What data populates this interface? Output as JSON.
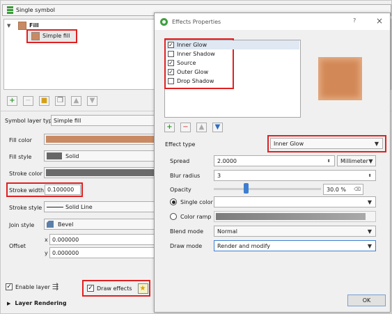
{
  "left_panel": {
    "header": {
      "title": "Single symbol"
    },
    "tree": {
      "root_label": "Fill",
      "child_label": "Simple fill"
    },
    "layer_type": {
      "label": "Symbol layer type",
      "value": "Simple fill"
    },
    "props": {
      "fill_color": {
        "label": "Fill color",
        "color": "#c98a63"
      },
      "fill_style": {
        "label": "Fill style",
        "value": "Solid"
      },
      "stroke_color": {
        "label": "Stroke color",
        "color": "#6b6b6b"
      },
      "stroke_width": {
        "label": "Stroke width",
        "value": "0.100000"
      },
      "stroke_style": {
        "label": "Stroke style",
        "value": "Solid Line"
      },
      "join_style": {
        "label": "Join style",
        "value": "Bevel"
      },
      "offset": {
        "label": "Offset",
        "x_label": "x",
        "x_value": "0.000000",
        "y_label": "y",
        "y_value": "0.000000"
      }
    },
    "enable_layer": {
      "label": "Enable layer",
      "checked": true
    },
    "draw_effects": {
      "label": "Draw effects",
      "checked": true
    },
    "layer_rendering": {
      "label": "Layer Rendering"
    }
  },
  "dialog": {
    "title": "Effects Properties",
    "help": "?",
    "close": "×",
    "effects": [
      {
        "label": "Inner Glow",
        "checked": true
      },
      {
        "label": "Inner Shadow",
        "checked": false
      },
      {
        "label": "Source",
        "checked": true
      },
      {
        "label": "Outer Glow",
        "checked": true
      },
      {
        "label": "Drop Shadow",
        "checked": false
      }
    ],
    "effect_type": {
      "label": "Effect type",
      "value": "Inner Glow"
    },
    "spread": {
      "label": "Spread",
      "value": "2.0000",
      "unit": "Millimeter"
    },
    "blur_radius": {
      "label": "Blur radius",
      "value": "3"
    },
    "opacity": {
      "label": "Opacity",
      "value": "30.0 %",
      "fraction": 0.3
    },
    "single_color": {
      "label": "Single color",
      "selected": true
    },
    "color_ramp": {
      "label": "Color ramp",
      "selected": false
    },
    "blend_mode": {
      "label": "Blend mode",
      "value": "Normal"
    },
    "draw_mode": {
      "label": "Draw mode",
      "value": "Render and modify"
    },
    "ok_label": "OK"
  },
  "colors": {
    "highlight": "#e02020",
    "fill": "#c98a63",
    "accent": "#3c7fd0"
  }
}
